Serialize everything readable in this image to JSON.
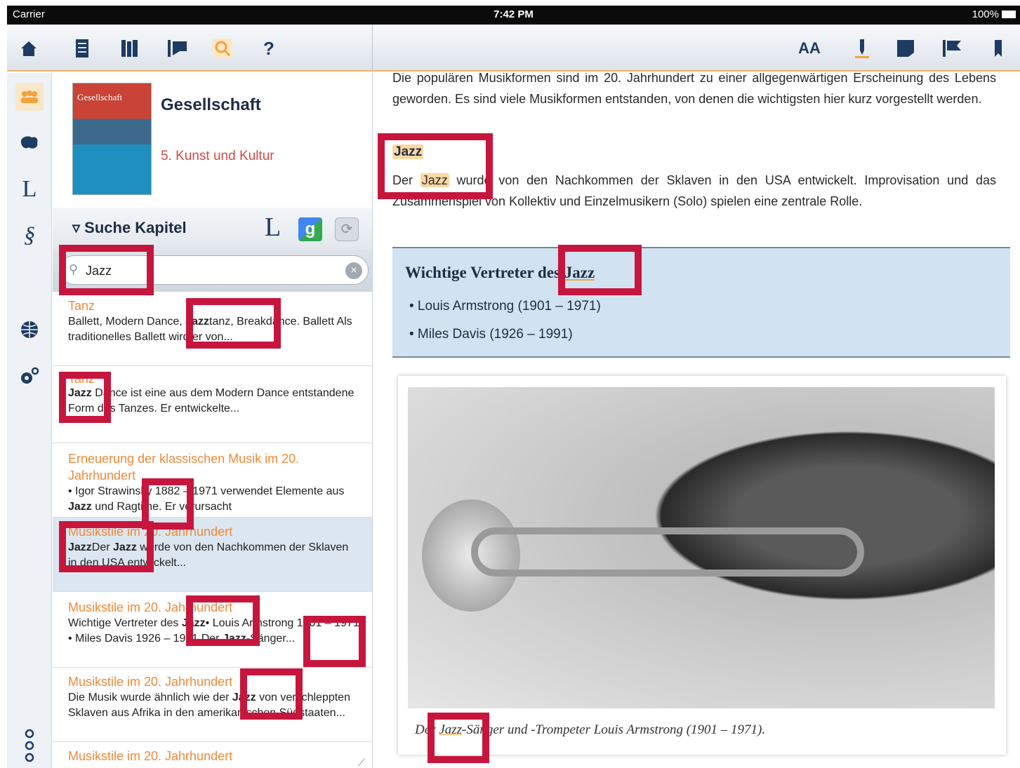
{
  "status": {
    "carrier": "Carrier",
    "time": "7:42 PM",
    "battery": "100%"
  },
  "toolbar_left": {
    "icons": [
      "home-icon",
      "notebook-icon",
      "books-icon",
      "bookmark-list-icon",
      "search-icon",
      "help-icon"
    ],
    "help_glyph": "?"
  },
  "toolbar_right": {
    "font_size_label": "AA",
    "icons": [
      "font-size-icon",
      "pin-icon",
      "note-icon",
      "flag-icon",
      "bookmark-icon"
    ]
  },
  "rail": {
    "lexicon_glyph": "L",
    "paragraph_glyph": "§"
  },
  "book": {
    "cover_title": "Gesellschaft",
    "title": "Gesellschaft",
    "chapter": "5. Kunst und Kultur"
  },
  "search": {
    "header_label": "▿ Suche Kapitel",
    "lexicon_btn": "L",
    "google_btn": "g",
    "query": "Jazz"
  },
  "results": [
    {
      "title": "Tanz",
      "text_html": "Ballett, Modern Dance, <b>Jazz</b>tanz, Breakdance. Ballett Als traditionelles Ballett wird er von..."
    },
    {
      "title": "Tanz",
      "text_html": "<b>Jazz</b> Dance ist eine aus dem Modern Dance entstandene Form des Tanzes. Er entwickelte..."
    },
    {
      "title": "Erneuerung der klassischen Musik im 20. Jahrhundert",
      "text_html": "• Igor Strawinsky 1882 – 1971 verwendet Elemente aus <b>Jazz</b> und Ragtime. Er verursacht"
    },
    {
      "title": "Musikstile im 20. Jahrhundert",
      "text_html": "<b>Jazz</b>Der <b>Jazz</b> wurde von den Nachkommen der Sklaven in den USA entwickelt..."
    },
    {
      "title": "Musikstile im 20. Jahrhundert",
      "text_html": "Wichtige Vertreter des <b>Jazz</b>• Louis Armstrong 1901 – 1971 • Miles Davis 1926 – 1991 Der <b>Jazz</b>-Sänger..."
    },
    {
      "title": "Musikstile im 20. Jahrhundert",
      "text_html": "Die Musik wurde ähnlich wie der <b>Jazz</b> von verschleppten Sklaven aus Afrika in den amerikanischen Südstaaten..."
    },
    {
      "title": "Musikstile im 20. Jahrhundert",
      "text_html": ""
    }
  ],
  "reader": {
    "intro": "Die populären Musikformen sind im 20. Jahrhundert zu einer allgegenwärtigen Erscheinung des Lebens geworden. Es sind viele Musikformen entstanden, von denen die wichtigsten hier kurz vorgestellt werden.",
    "section_heading": "Jazz",
    "section_text_before": "Der ",
    "section_text_hl": "Jazz",
    "section_text_after": " wurde von den Nachkommen der Sklaven in den USA entwickelt. Improvisation und das Zusammenspiel von Kollektiv und Einzelmusikern (Solo) spielen eine zentrale Rolle.",
    "infobox_title_prefix": "Wichtige Vertreter des ",
    "infobox_title_hl": "Jazz",
    "infobox_items": [
      "• Louis Armstrong (1901 – 1971)",
      "• Miles Davis (1926 – 1991)"
    ],
    "caption_prefix": "Der ",
    "caption_hl": "Jazz",
    "caption_suffix": "-Sänger und -Trompeter Louis Armstrong (1901 – 1971)."
  },
  "colors": {
    "accent": "#f3a33c",
    "result_title": "#f08a3a",
    "chapter": "#d24b45",
    "annotation": "#c7163d",
    "infobox": "#d1e2f0"
  }
}
